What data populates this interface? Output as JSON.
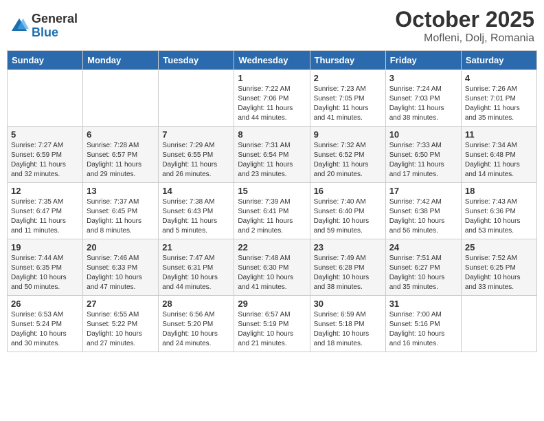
{
  "header": {
    "logo_general": "General",
    "logo_blue": "Blue",
    "month_year": "October 2025",
    "location": "Mofleni, Dolj, Romania"
  },
  "weekdays": [
    "Sunday",
    "Monday",
    "Tuesday",
    "Wednesday",
    "Thursday",
    "Friday",
    "Saturday"
  ],
  "weeks": [
    [
      {
        "day": "",
        "info": ""
      },
      {
        "day": "",
        "info": ""
      },
      {
        "day": "",
        "info": ""
      },
      {
        "day": "1",
        "info": "Sunrise: 7:22 AM\nSunset: 7:06 PM\nDaylight: 11 hours\nand 44 minutes."
      },
      {
        "day": "2",
        "info": "Sunrise: 7:23 AM\nSunset: 7:05 PM\nDaylight: 11 hours\nand 41 minutes."
      },
      {
        "day": "3",
        "info": "Sunrise: 7:24 AM\nSunset: 7:03 PM\nDaylight: 11 hours\nand 38 minutes."
      },
      {
        "day": "4",
        "info": "Sunrise: 7:26 AM\nSunset: 7:01 PM\nDaylight: 11 hours\nand 35 minutes."
      }
    ],
    [
      {
        "day": "5",
        "info": "Sunrise: 7:27 AM\nSunset: 6:59 PM\nDaylight: 11 hours\nand 32 minutes."
      },
      {
        "day": "6",
        "info": "Sunrise: 7:28 AM\nSunset: 6:57 PM\nDaylight: 11 hours\nand 29 minutes."
      },
      {
        "day": "7",
        "info": "Sunrise: 7:29 AM\nSunset: 6:55 PM\nDaylight: 11 hours\nand 26 minutes."
      },
      {
        "day": "8",
        "info": "Sunrise: 7:31 AM\nSunset: 6:54 PM\nDaylight: 11 hours\nand 23 minutes."
      },
      {
        "day": "9",
        "info": "Sunrise: 7:32 AM\nSunset: 6:52 PM\nDaylight: 11 hours\nand 20 minutes."
      },
      {
        "day": "10",
        "info": "Sunrise: 7:33 AM\nSunset: 6:50 PM\nDaylight: 11 hours\nand 17 minutes."
      },
      {
        "day": "11",
        "info": "Sunrise: 7:34 AM\nSunset: 6:48 PM\nDaylight: 11 hours\nand 14 minutes."
      }
    ],
    [
      {
        "day": "12",
        "info": "Sunrise: 7:35 AM\nSunset: 6:47 PM\nDaylight: 11 hours\nand 11 minutes."
      },
      {
        "day": "13",
        "info": "Sunrise: 7:37 AM\nSunset: 6:45 PM\nDaylight: 11 hours\nand 8 minutes."
      },
      {
        "day": "14",
        "info": "Sunrise: 7:38 AM\nSunset: 6:43 PM\nDaylight: 11 hours\nand 5 minutes."
      },
      {
        "day": "15",
        "info": "Sunrise: 7:39 AM\nSunset: 6:41 PM\nDaylight: 11 hours\nand 2 minutes."
      },
      {
        "day": "16",
        "info": "Sunrise: 7:40 AM\nSunset: 6:40 PM\nDaylight: 10 hours\nand 59 minutes."
      },
      {
        "day": "17",
        "info": "Sunrise: 7:42 AM\nSunset: 6:38 PM\nDaylight: 10 hours\nand 56 minutes."
      },
      {
        "day": "18",
        "info": "Sunrise: 7:43 AM\nSunset: 6:36 PM\nDaylight: 10 hours\nand 53 minutes."
      }
    ],
    [
      {
        "day": "19",
        "info": "Sunrise: 7:44 AM\nSunset: 6:35 PM\nDaylight: 10 hours\nand 50 minutes."
      },
      {
        "day": "20",
        "info": "Sunrise: 7:46 AM\nSunset: 6:33 PM\nDaylight: 10 hours\nand 47 minutes."
      },
      {
        "day": "21",
        "info": "Sunrise: 7:47 AM\nSunset: 6:31 PM\nDaylight: 10 hours\nand 44 minutes."
      },
      {
        "day": "22",
        "info": "Sunrise: 7:48 AM\nSunset: 6:30 PM\nDaylight: 10 hours\nand 41 minutes."
      },
      {
        "day": "23",
        "info": "Sunrise: 7:49 AM\nSunset: 6:28 PM\nDaylight: 10 hours\nand 38 minutes."
      },
      {
        "day": "24",
        "info": "Sunrise: 7:51 AM\nSunset: 6:27 PM\nDaylight: 10 hours\nand 35 minutes."
      },
      {
        "day": "25",
        "info": "Sunrise: 7:52 AM\nSunset: 6:25 PM\nDaylight: 10 hours\nand 33 minutes."
      }
    ],
    [
      {
        "day": "26",
        "info": "Sunrise: 6:53 AM\nSunset: 5:24 PM\nDaylight: 10 hours\nand 30 minutes."
      },
      {
        "day": "27",
        "info": "Sunrise: 6:55 AM\nSunset: 5:22 PM\nDaylight: 10 hours\nand 27 minutes."
      },
      {
        "day": "28",
        "info": "Sunrise: 6:56 AM\nSunset: 5:20 PM\nDaylight: 10 hours\nand 24 minutes."
      },
      {
        "day": "29",
        "info": "Sunrise: 6:57 AM\nSunset: 5:19 PM\nDaylight: 10 hours\nand 21 minutes."
      },
      {
        "day": "30",
        "info": "Sunrise: 6:59 AM\nSunset: 5:18 PM\nDaylight: 10 hours\nand 18 minutes."
      },
      {
        "day": "31",
        "info": "Sunrise: 7:00 AM\nSunset: 5:16 PM\nDaylight: 10 hours\nand 16 minutes."
      },
      {
        "day": "",
        "info": ""
      }
    ]
  ]
}
